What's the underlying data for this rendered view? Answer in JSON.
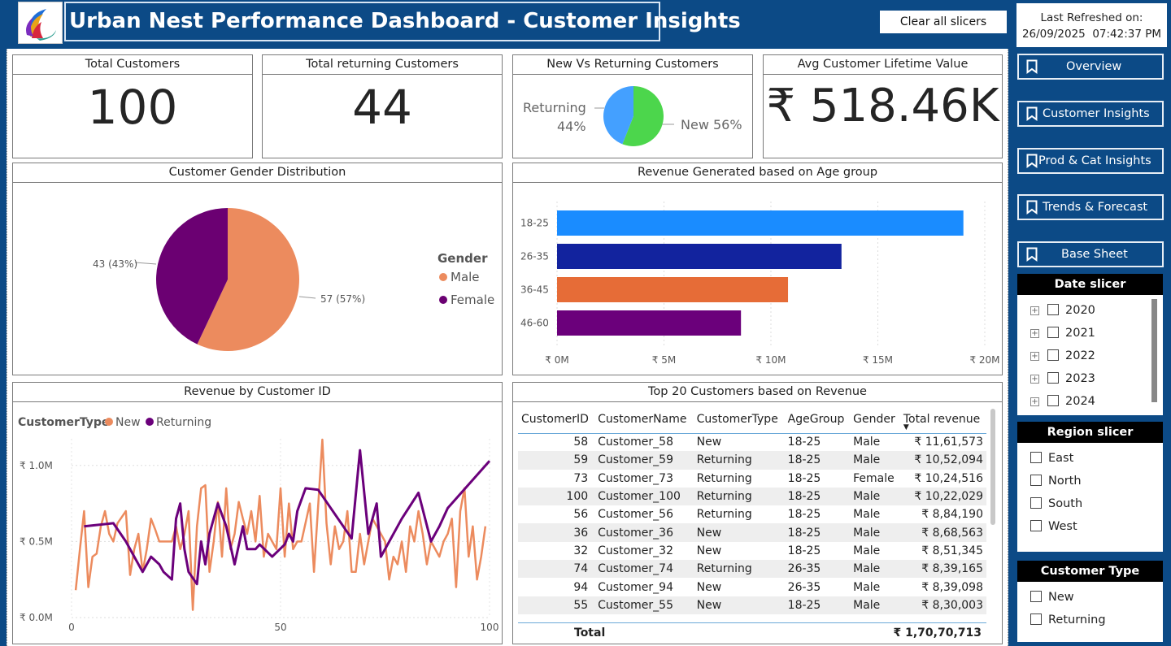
{
  "header": {
    "title": "Urban Nest Performance Dashboard - Customer Insights",
    "clear_label": "Clear all slicers",
    "refresh_label": "Last Refreshed on:",
    "refresh_value": "26/09/2025  07:42:37 PM"
  },
  "kpis": {
    "total_customers": {
      "title": "Total Customers",
      "value": "100"
    },
    "returning_customers": {
      "title": "Total returning Customers",
      "value": "44"
    },
    "avg_clv": {
      "title": "Avg Customer Lifetime Value",
      "value": "₹ 518.46K"
    }
  },
  "nav": [
    {
      "label": "Overview",
      "icon": "bookmark-icon"
    },
    {
      "label": "Customer Insights",
      "icon": "bookmark-icon"
    },
    {
      "label": "Prod & Cat Insights",
      "icon": "bookmark-icon"
    },
    {
      "label": "Trends & Forecast",
      "icon": "bookmark-icon"
    },
    {
      "label": "Base Sheet",
      "icon": "bookmark-icon"
    }
  ],
  "slicers": {
    "date": {
      "title": "Date slicer",
      "items": [
        "2020",
        "2021",
        "2022",
        "2023",
        "2024"
      ]
    },
    "region": {
      "title": "Region slicer",
      "items": [
        "East",
        "North",
        "South",
        "West"
      ]
    },
    "customer_type": {
      "title": "Customer Type",
      "items": [
        "New",
        "Returning"
      ]
    }
  },
  "colors": {
    "male": "#ec8b5e",
    "female": "#6b0072",
    "new": "#4cd64c",
    "returning": "#44a0ff",
    "age_colors": [
      "#1a8cff",
      "#12239e",
      "#e66c37",
      "#6b007b"
    ],
    "line_new": "#ec8b5e",
    "line_returning": "#6b007b"
  },
  "table": {
    "title": "Top 20 Customers based on Revenue",
    "columns": [
      "CustomerID",
      "CustomerName",
      "CustomerType",
      "AgeGroup",
      "Gender",
      "Total revenue"
    ],
    "rows": [
      [
        "58",
        "Customer_58",
        "New",
        "18-25",
        "Male",
        "₹ 11,61,573"
      ],
      [
        "59",
        "Customer_59",
        "Returning",
        "18-25",
        "Male",
        "₹ 10,52,094"
      ],
      [
        "73",
        "Customer_73",
        "Returning",
        "18-25",
        "Female",
        "₹ 10,24,516"
      ],
      [
        "100",
        "Customer_100",
        "Returning",
        "18-25",
        "Male",
        "₹ 10,22,029"
      ],
      [
        "56",
        "Customer_56",
        "Returning",
        "18-25",
        "Male",
        "₹ 8,84,190"
      ],
      [
        "36",
        "Customer_36",
        "New",
        "18-25",
        "Male",
        "₹ 8,68,563"
      ],
      [
        "32",
        "Customer_32",
        "New",
        "18-25",
        "Male",
        "₹ 8,51,345"
      ],
      [
        "74",
        "Customer_74",
        "Returning",
        "26-35",
        "Male",
        "₹ 8,39,165"
      ],
      [
        "94",
        "Customer_94",
        "New",
        "26-35",
        "Male",
        "₹ 8,39,098"
      ],
      [
        "55",
        "Customer_55",
        "New",
        "18-25",
        "Male",
        "₹ 8,30,003"
      ]
    ],
    "total_label": "Total",
    "total_value": "₹ 1,70,70,713"
  },
  "chart_data": [
    {
      "type": "pie",
      "title": "New Vs Returning Customers",
      "categories": [
        "New",
        "Returning"
      ],
      "values": [
        56,
        44
      ],
      "labels": [
        "New 56%",
        "Returning 44%"
      ]
    },
    {
      "type": "pie",
      "title": "Customer Gender Distribution",
      "legend_title": "Gender",
      "categories": [
        "Male",
        "Female"
      ],
      "values": [
        57,
        43
      ],
      "labels": [
        "57 (57%)",
        "43 (43%)"
      ]
    },
    {
      "type": "bar",
      "title": "Revenue Generated based on Age group",
      "categories": [
        "18-25",
        "26-35",
        "36-45",
        "46-60"
      ],
      "values": [
        19.0,
        13.3,
        10.8,
        8.6
      ],
      "unit": "₹ M",
      "xlim": [
        0,
        20
      ],
      "ticks": [
        "₹ 0M",
        "₹ 5M",
        "₹ 10M",
        "₹ 15M",
        "₹ 20M"
      ]
    },
    {
      "type": "line",
      "title": "Revenue by Customer ID",
      "legend_title": "CustomerType",
      "x_ticks": [
        "0",
        "50",
        "100"
      ],
      "y_ticks": [
        "₹ 0.0M",
        "₹ 0.5M",
        "₹ 1.0M"
      ],
      "xlim": [
        0,
        100
      ],
      "ylim": [
        0,
        1.25
      ],
      "series": [
        {
          "name": "New",
          "x": [
            1,
            2,
            3,
            4,
            5,
            6,
            7,
            8,
            9,
            10,
            11,
            12,
            13,
            14,
            15,
            16,
            17,
            18,
            19,
            20,
            21,
            22,
            23,
            24,
            25,
            26,
            27,
            28,
            29,
            30,
            31,
            32,
            33,
            34,
            35,
            36,
            37,
            38,
            39,
            40,
            41,
            42,
            43,
            44,
            45,
            46,
            47,
            48,
            49,
            50,
            51,
            52,
            53,
            54,
            55,
            57,
            58,
            60,
            61,
            62,
            63,
            64,
            65,
            66,
            67,
            68,
            69,
            70,
            71,
            72,
            75,
            76,
            77,
            78,
            79,
            80,
            81,
            82,
            83,
            84,
            85,
            86,
            87,
            88,
            89,
            90,
            91,
            92,
            93,
            94,
            95,
            96,
            97,
            98,
            99
          ],
          "y": [
            0.18,
            0.45,
            0.7,
            0.2,
            0.4,
            0.42,
            0.6,
            0.7,
            0.55,
            0.5,
            0.62,
            0.66,
            0.7,
            0.28,
            0.45,
            0.55,
            0.3,
            0.45,
            0.65,
            0.58,
            0.5,
            0.5,
            0.5,
            0.5,
            0.6,
            0.45,
            0.55,
            0.7,
            0.05,
            0.6,
            0.85,
            0.87,
            0.3,
            0.5,
            0.76,
            0.4,
            0.85,
            0.45,
            0.55,
            0.76,
            0.65,
            0.55,
            0.7,
            0.5,
            0.8,
            0.4,
            0.55,
            0.5,
            0.45,
            0.85,
            0.4,
            0.75,
            0.45,
            0.5,
            0.5,
            0.75,
            0.3,
            1.17,
            0.62,
            0.35,
            0.6,
            0.45,
            0.5,
            0.7,
            0.3,
            0.3,
            0.55,
            0.35,
            0.5,
            0.65,
            0.5,
            0.25,
            0.4,
            0.35,
            0.5,
            0.3,
            0.6,
            0.5,
            0.7,
            0.55,
            0.35,
            0.5,
            0.45,
            0.4,
            0.5,
            0.55,
            0.65,
            0.2,
            0.7,
            0.85,
            0.4,
            0.6,
            0.25,
            0.4,
            0.6
          ]
        },
        {
          "name": "Returning",
          "x": [
            3,
            10,
            13,
            17,
            19,
            21,
            22,
            24,
            25,
            26,
            27,
            28,
            30,
            31,
            32,
            33,
            35,
            37,
            39,
            41,
            42,
            44,
            45,
            48,
            51,
            52,
            53,
            54,
            56,
            59,
            67,
            69,
            71,
            73,
            74,
            79,
            83,
            86,
            88,
            90,
            100
          ],
          "y": [
            0.6,
            0.62,
            0.5,
            0.3,
            0.4,
            0.35,
            0.3,
            0.25,
            0.65,
            0.75,
            0.45,
            0.3,
            0.22,
            0.5,
            0.35,
            0.55,
            0.75,
            0.6,
            0.35,
            0.6,
            0.45,
            0.45,
            0.48,
            0.4,
            0.48,
            0.55,
            0.5,
            0.7,
            0.85,
            0.84,
            0.52,
            1.1,
            0.55,
            0.75,
            0.4,
            0.65,
            0.82,
            0.5,
            0.6,
            0.72,
            1.03
          ]
        }
      ]
    }
  ]
}
